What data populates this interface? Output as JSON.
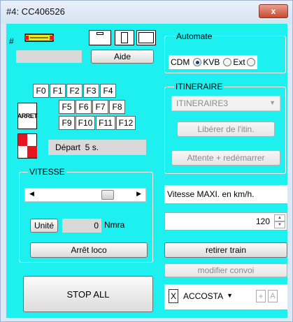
{
  "window": {
    "title": "#4: CC406526",
    "close_glyph": "x"
  },
  "top_left": {
    "hash_label": "#",
    "aide_label": "Aide"
  },
  "automate": {
    "title": "Automate",
    "options": [
      "CDM",
      "KVB",
      "Ext"
    ],
    "selected": "KVB"
  },
  "function_keys": [
    "F0",
    "F1",
    "F2",
    "F3",
    "F4",
    "F5",
    "F6",
    "F7",
    "F8",
    "F9",
    "F10",
    "F11",
    "F12"
  ],
  "arret_sign": "ARRET",
  "depart": {
    "label": "Départ  5 s."
  },
  "itineraire": {
    "title": "ITINERAIRE",
    "select_value": "ITINERAIRE3",
    "liberer_label": "Libérer de l'itin.",
    "attente_label": "Attente + redémarrer"
  },
  "vitesse": {
    "title": "VITESSE",
    "slider_fraction": 0.78,
    "unite_label": "Unité",
    "speed_value": "0",
    "speed_unit": "Nmra",
    "arret_loco_label": "Arrêt loco"
  },
  "vitesse_maxi": {
    "label": "Vitesse MAXI. en km/h.",
    "value": "120"
  },
  "retirer_label": "retirer train",
  "modifier_label": "modifier convoi",
  "stop_all_label": "STOP ALL",
  "bottom_row": {
    "x_label": "X",
    "select_value": "ACCOSTA",
    "plus_label": "+",
    "a_label": "A"
  },
  "colors": {
    "client_bg": "#1ef0f0",
    "title_bg": "#dde8f5",
    "close_red": "#c94a30",
    "marker_red": "#e8141e",
    "loco_yellow": "#f5e81a"
  }
}
